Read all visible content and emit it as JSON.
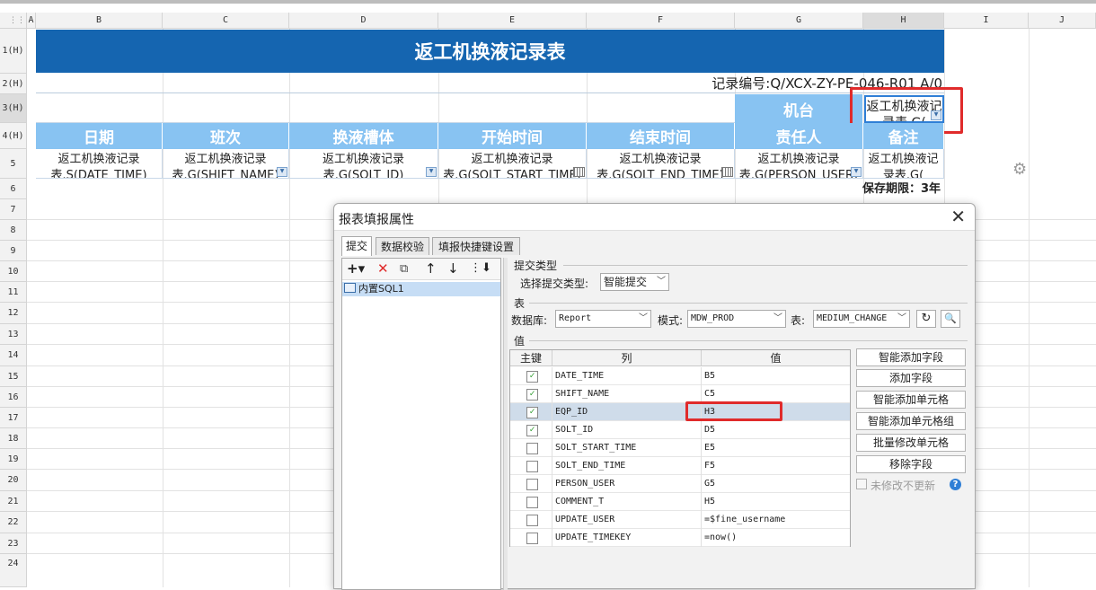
{
  "sheet": {
    "columns": [
      "A",
      "B",
      "C",
      "D",
      "E",
      "F",
      "G",
      "H",
      "I",
      "J"
    ],
    "rows": [
      "1(H)",
      "2(H)",
      "3(H)",
      "4(H)",
      "5",
      "6",
      "7",
      "8",
      "9",
      "10",
      "11",
      "12",
      "13",
      "14",
      "15",
      "16",
      "17",
      "18",
      "19",
      "20",
      "21",
      "22",
      "23",
      "24"
    ],
    "title": "返工机换液记录表",
    "record_no": "记录编号:Q/XCX-ZY-PE-046-R01 A/0",
    "machine_label": "机台",
    "h3_value": "返工机换液记录表.G(",
    "headers": [
      "日期",
      "班次",
      "换液槽体",
      "开始时间",
      "结束时间",
      "责任人",
      "备注"
    ],
    "row5": [
      "返工机换液记录表.S(DATE_TIME)",
      "返工机换液记录表.G(SHIFT_NAME)",
      "返工机换液记录表.G(SOLT_ID)",
      "返工机换液记录表.G(SOLT_START_TIME)",
      "返工机换液记录表.G(SOLT_END_TIME)",
      "返工机换液记录表.G(PERSON_USER)",
      "返工机换液记录表.G("
    ],
    "retention": "保存期限：3年"
  },
  "dialog": {
    "title": "报表填报属性",
    "close": "✕",
    "tabs": [
      "提交",
      "数据校验",
      "填报快捷键设置"
    ],
    "tree_item": "内置SQL1",
    "submit_type_section": "提交类型",
    "submit_type_label": "选择提交类型:",
    "submit_type_value": "智能提交",
    "table_section": "表",
    "db_label": "数据库:",
    "db_value": "Report",
    "schema_label": "模式:",
    "schema_value": "MDW_PROD",
    "table_label": "表:",
    "table_value": "MEDIUM_CHANGE",
    "value_section": "值",
    "col_headers": [
      "主键",
      "列",
      "值"
    ],
    "rows": [
      {
        "key": true,
        "col": "DATE_TIME",
        "val": "B5"
      },
      {
        "key": true,
        "col": "SHIFT_NAME",
        "val": "C5"
      },
      {
        "key": true,
        "col": "EQP_ID",
        "val": "H3"
      },
      {
        "key": true,
        "col": "SOLT_ID",
        "val": "D5"
      },
      {
        "key": false,
        "col": "SOLT_START_TIME",
        "val": "E5"
      },
      {
        "key": false,
        "col": "SOLT_END_TIME",
        "val": "F5"
      },
      {
        "key": false,
        "col": "PERSON_USER",
        "val": "G5"
      },
      {
        "key": false,
        "col": "COMMENT_T",
        "val": "H5"
      },
      {
        "key": false,
        "col": "UPDATE_USER",
        "val": "=$fine_username"
      },
      {
        "key": false,
        "col": "UPDATE_TIMEKEY",
        "val": "=now()"
      }
    ],
    "side_buttons": [
      "智能添加字段",
      "添加字段",
      "智能添加单元格",
      "智能添加单元格组",
      "批量修改单元格",
      "移除字段"
    ],
    "no_update_label": "未修改不更新",
    "help": "?"
  },
  "colors": {
    "title_bg": "#1565b0",
    "header_bg": "#88c3f2",
    "highlight": "#e02b2b"
  }
}
